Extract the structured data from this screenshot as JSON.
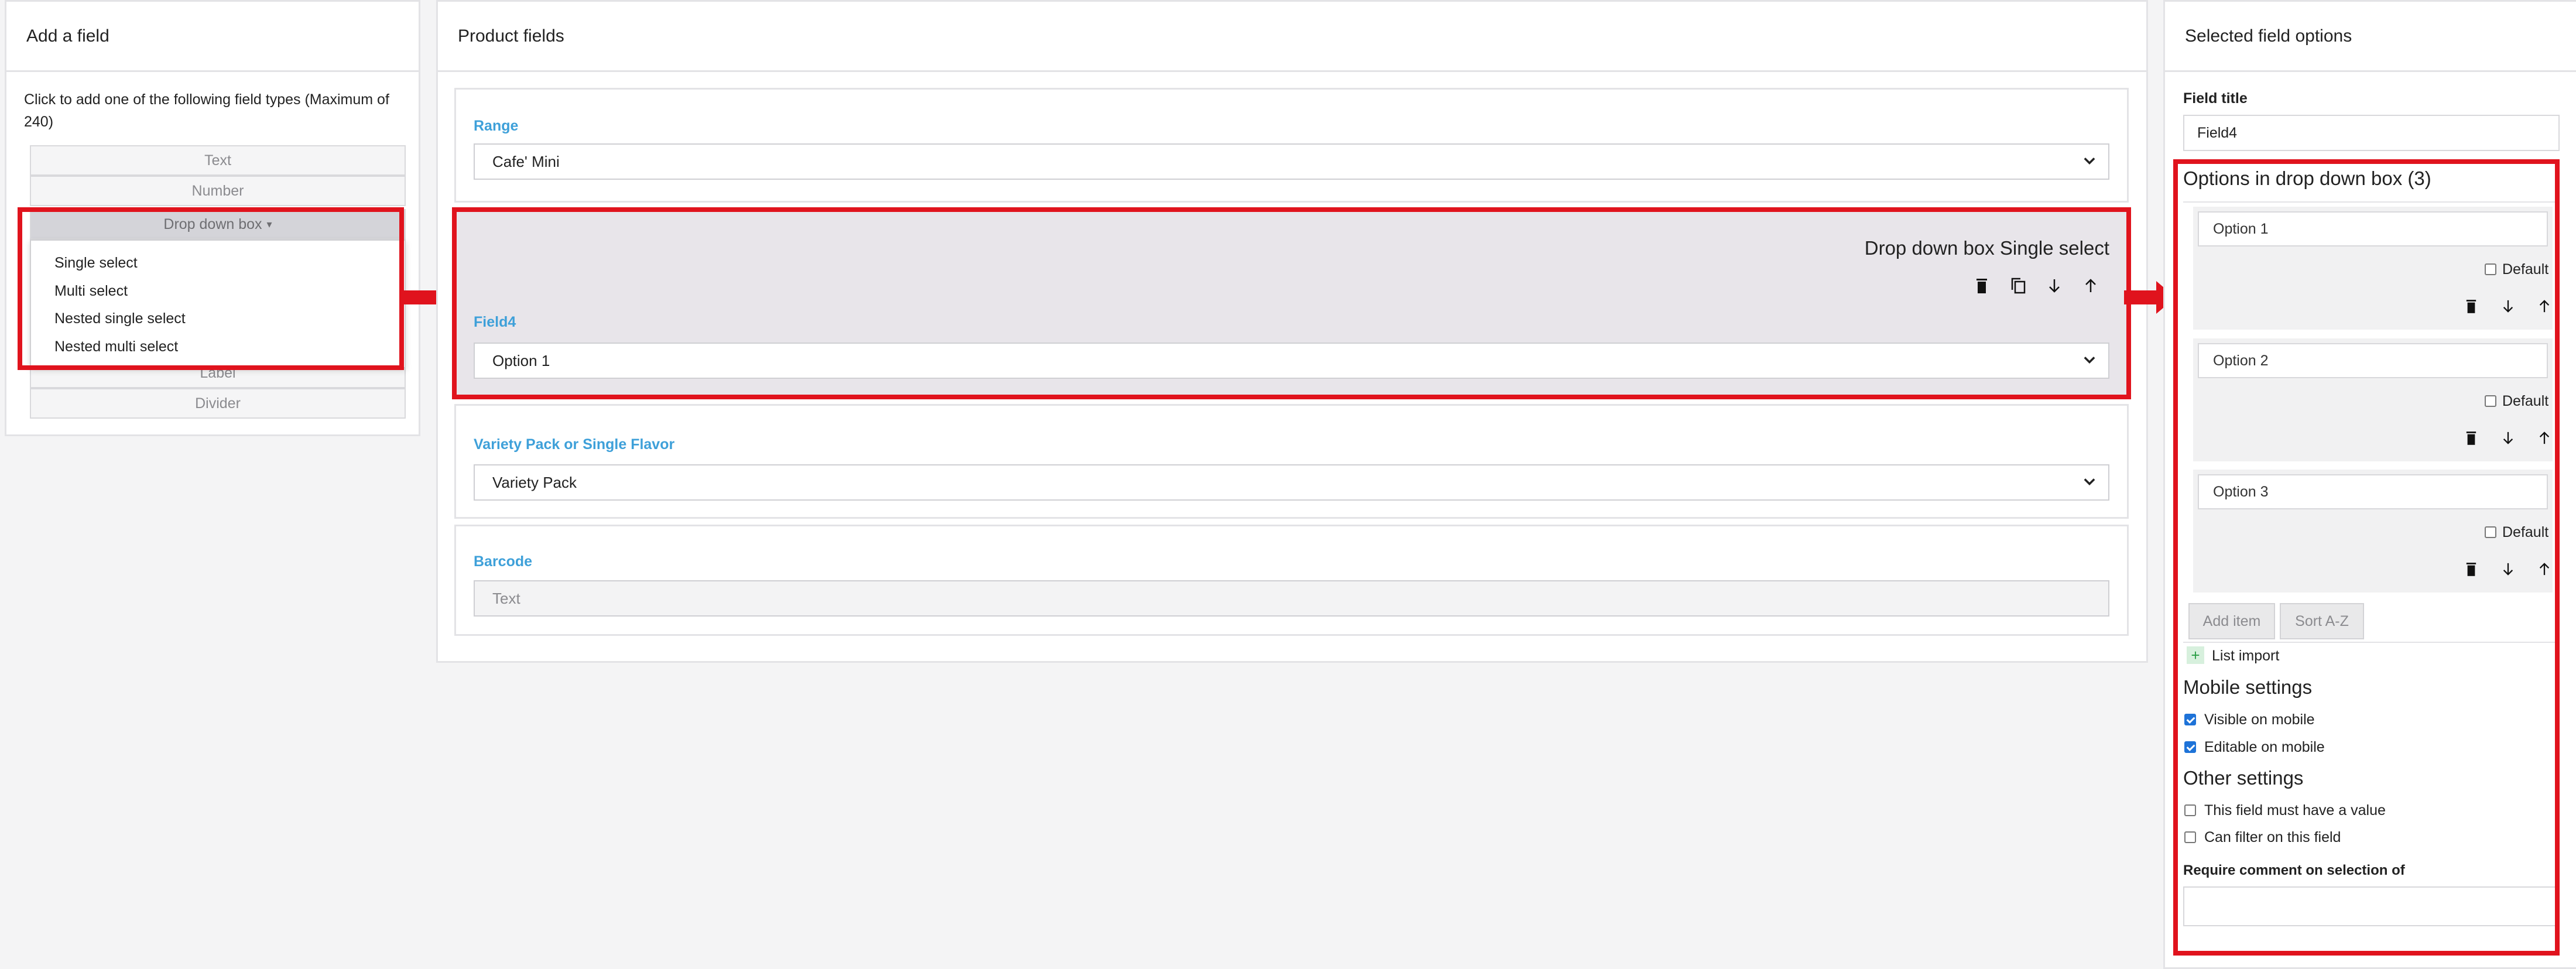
{
  "left_panel": {
    "title": "Add a field",
    "instructions": "Click to add one of the following field types (Maximum of 240)",
    "field_types": [
      "Text",
      "Number",
      "Drop down box",
      "Label",
      "Divider"
    ],
    "dropdown_options": [
      "Single select",
      "Multi select",
      "Nested single select",
      "Nested multi select"
    ]
  },
  "middle_panel": {
    "title": "Product fields",
    "fields": [
      {
        "label": "Range",
        "value": "Cafe' Mini",
        "type": "select"
      },
      {
        "label": "Field4",
        "value": "Option 1",
        "type": "select",
        "header": "Drop down box Single select"
      },
      {
        "label": "Variety Pack or Single Flavor",
        "value": "Variety Pack",
        "type": "select"
      },
      {
        "label": "Barcode",
        "placeholder": "Text",
        "type": "text"
      }
    ]
  },
  "right_panel": {
    "title": "Selected field options",
    "field_title_label": "Field title",
    "field_title_value": "Field4",
    "options_heading": "Options in drop down box (3)",
    "options": [
      {
        "value": "Option 1",
        "default_label": "Default",
        "default": false
      },
      {
        "value": "Option 2",
        "default_label": "Default",
        "default": false
      },
      {
        "value": "Option 3",
        "default_label": "Default",
        "default": false
      }
    ],
    "add_item": "Add item",
    "sort": "Sort A-Z",
    "list_import": "List import",
    "mobile_heading": "Mobile settings",
    "visible_on_mobile": "Visible on mobile",
    "editable_on_mobile": "Editable on mobile",
    "other_heading": "Other settings",
    "must_have_value": "This field must have a value",
    "can_filter": "Can filter on this field",
    "require_comment": "Require comment on selection of"
  },
  "colors": {
    "accent": "#3ea0d9",
    "highlight": "#e0131d",
    "selected_bg": "#e8e5ea"
  }
}
